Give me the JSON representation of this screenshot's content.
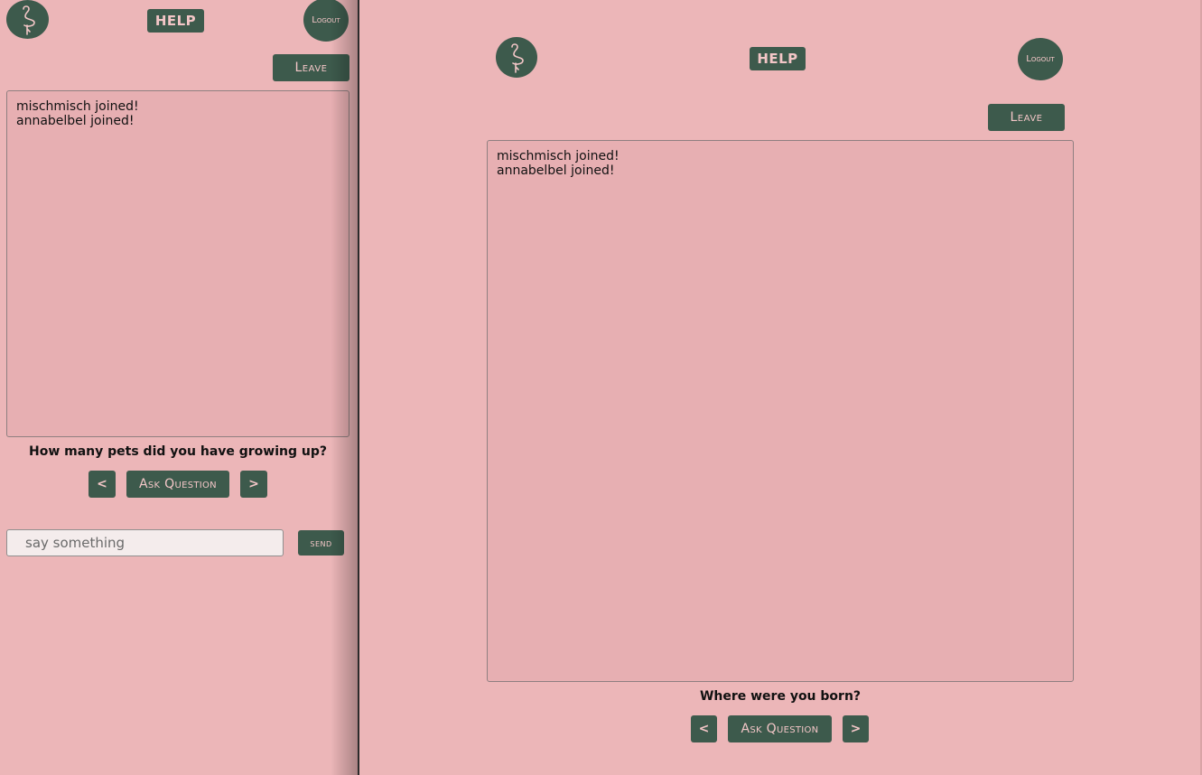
{
  "colors": {
    "background": "#ecb6b8",
    "accent": "#3d5a4c",
    "accent_text": "#f3c6c7",
    "chat_bg": "#e7afb2"
  },
  "left": {
    "logo_icon": "flamingo-icon",
    "help_label": "HELP",
    "logout_label": "Logout",
    "leave_label": "Leave",
    "messages": [
      "mischmisch joined!",
      "annabelbel joined!"
    ],
    "question": "How many pets did you have growing up?",
    "prev_label": "<",
    "ask_label": "Ask Question",
    "next_label": ">",
    "input_placeholder": "say something",
    "send_label": "send"
  },
  "right": {
    "logo_icon": "flamingo-icon",
    "help_label": "HELP",
    "logout_label": "Logout",
    "leave_label": "Leave",
    "messages": [
      "mischmisch joined!",
      "annabelbel joined!"
    ],
    "question": "Where were you born?",
    "prev_label": "<",
    "ask_label": "Ask Question",
    "next_label": ">"
  }
}
